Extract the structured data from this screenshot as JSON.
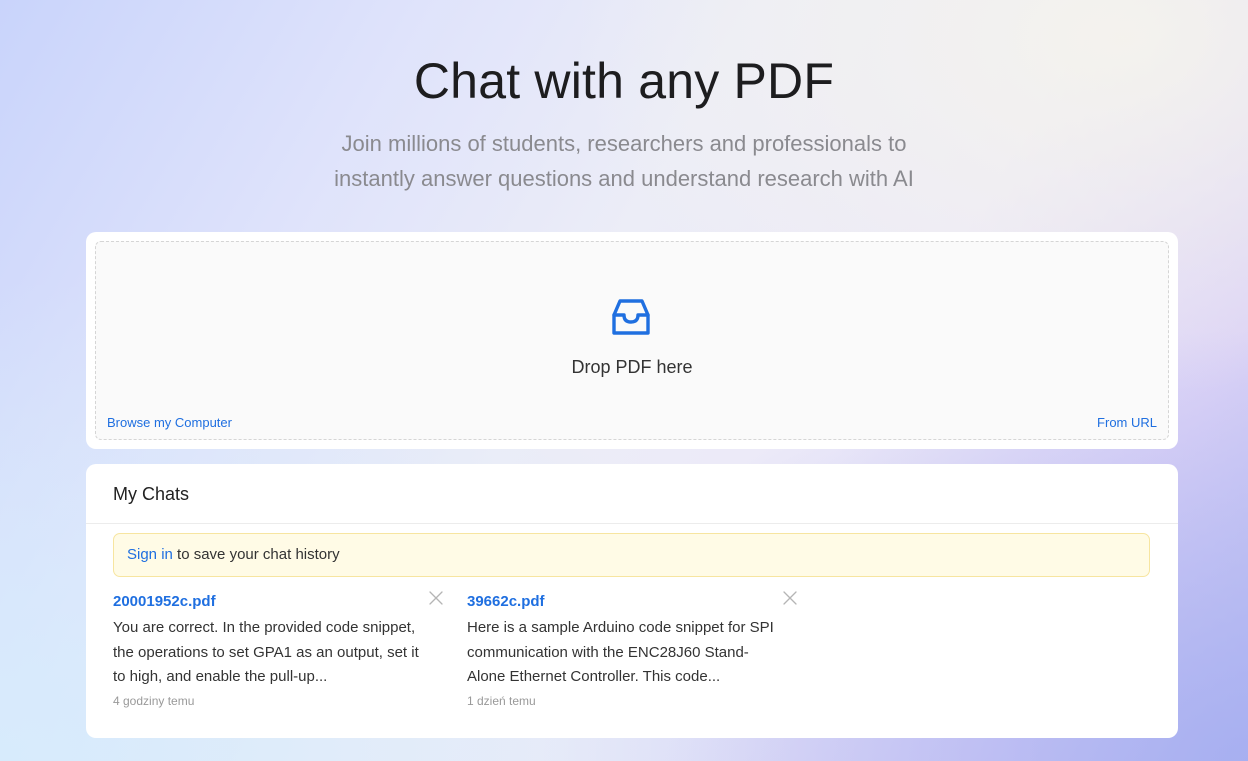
{
  "hero": {
    "title": "Chat with any PDF",
    "subtitle": "Join millions of students, researchers and professionals to instantly answer questions and understand research with AI"
  },
  "upload": {
    "icon": "inbox-icon",
    "drop_text": "Drop PDF here",
    "browse_label": "Browse my Computer",
    "url_label": "From URL"
  },
  "chats": {
    "title": "My Chats",
    "signin_link": "Sign in",
    "signin_text": " to save your chat history",
    "items": [
      {
        "title": "20001952c.pdf",
        "snippet": "You are correct. In the provided code snippet, the operations to set GPA1 as an output, set it to high, and enable the pull-up...",
        "time": "4 godziny temu"
      },
      {
        "title": "39662c.pdf",
        "snippet": "Here is a sample Arduino code snippet for SPI communication with the ENC28J60 Stand-Alone Ethernet Controller. This code...",
        "time": "1 dzień temu"
      }
    ]
  },
  "colors": {
    "accent": "#1f6fe0",
    "banner_bg": "#fffbe6",
    "banner_border": "#f7e5a0"
  }
}
